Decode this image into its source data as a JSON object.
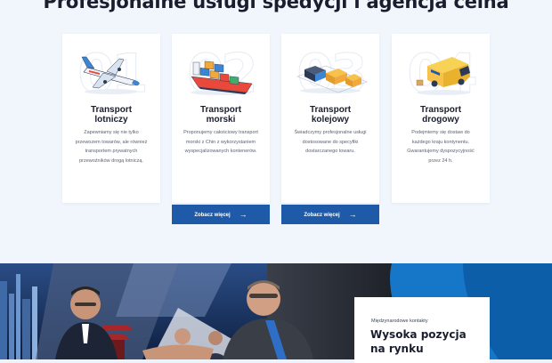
{
  "section": {
    "title": "Profesjonalne usługi spedycji i agencja celna"
  },
  "cards": [
    {
      "number": "01",
      "title": "Transport\nlotniczy",
      "description": "Zapewniamy się nie tylko przewozem towarów, ale również transportem prywatnych przewoźników drogą lotniczą.",
      "illustration": "airplane-illustration"
    },
    {
      "number": "02",
      "title": "Transport\nmorski",
      "description": "Proponujemy całościowy transport morski z Chin z wykorzystaniem wyspecjalizowanych kontenerów.",
      "illustration": "container-ship-illustration",
      "button": "Zobacz więcej"
    },
    {
      "number": "03",
      "title": "Transport\nkolejowy",
      "description": "Świadczymy profesjonalne usługi dostosowane do specyfiki dostarczanego towaru.",
      "illustration": "freight-train-illustration",
      "button": "Zobacz więcej"
    },
    {
      "number": "04",
      "title": "Transport\ndrogowy",
      "description": "Podejmiemy się dostaw do każdego kraju kontynentu. Gwarantujemy dyspozycyjność przez 24 h.",
      "illustration": "delivery-van-illustration"
    }
  ],
  "info": {
    "kicker": "Międzynarodowe kontakty",
    "title": "Wysoka pozycja na rynku"
  },
  "colors": {
    "accent": "#1f5aa8",
    "background": "#f1f5fc",
    "heading": "#1a1d2e"
  },
  "icons": {
    "button_arrow": "arrow-right-icon"
  }
}
